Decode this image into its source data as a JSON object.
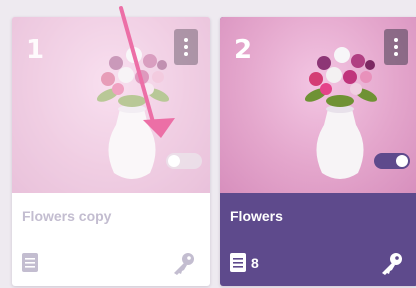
{
  "cards": [
    {
      "number": "1",
      "title": "Flowers copy",
      "toggle_on": false,
      "count": "",
      "icons": [
        "more-vertical-icon",
        "document-icon",
        "key-icon"
      ]
    },
    {
      "number": "2",
      "title": "Flowers",
      "toggle_on": true,
      "count": "8",
      "icons": [
        "more-vertical-icon",
        "document-icon",
        "key-icon"
      ]
    }
  ],
  "colors": {
    "accent": "#5e4a8c",
    "arrow": "#ec6fa6",
    "card_bg": "#ffffff",
    "page_bg": "#eeeaf0"
  }
}
